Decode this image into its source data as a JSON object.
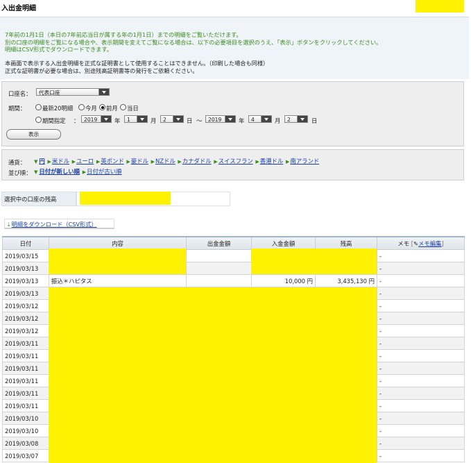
{
  "page": {
    "title": "入出金明細"
  },
  "notice": {
    "lines_green": [
      "7年前の1月1日（本日の7年前応当日が属する年の1月1日）までの明細をご覧いただけます。",
      "別の口座の明細をご覧になる場合や、表示期間を変えてご覧になる場合は、以下の必要項目を選択のうえ、「表示」ボタンをクリックしてください。",
      "明細はCSV形式でダウンロードできます。"
    ],
    "lines_dark": [
      "本画面で表示する入出金明細を正式な証明書として使用することはできません。（印刷した場合も同様）",
      "正式な証明書が必要な場合は、別途残高証明書等の発行をご依頼ください。"
    ]
  },
  "filter": {
    "account_label": "口座名：",
    "account_value": "代表口座",
    "period_label": "期間：",
    "radio_latest20": "最新20明細",
    "radio_this_month": "今月",
    "radio_last_month": "前月",
    "radio_today": "当日",
    "radio_range": "期間指定",
    "range_colon": "：",
    "from_year": "2019",
    "from_month": "1",
    "from_day": "2",
    "to_year": "2019",
    "to_month": "4",
    "to_day": "2",
    "unit_year": "年",
    "unit_month": "月",
    "unit_day": "日",
    "tilde": "～",
    "selected_radio": "前月",
    "show_button": "表示"
  },
  "currency": {
    "label": "通貨：",
    "items": [
      "円",
      "米ドル",
      "ユーロ",
      "英ポンド",
      "豪ドル",
      "NZドル",
      "カナダドル",
      "スイスフラン",
      "香港ドル",
      "南アランド"
    ],
    "selected": "円",
    "sort_label": "並び順：",
    "sort_items": [
      "日付が新しい順",
      "日付が古い順"
    ],
    "sort_selected": "日付が新しい順"
  },
  "balance": {
    "label": "選択中の口座の残高"
  },
  "download": {
    "label": "明細をダウンロード（CSV形式）"
  },
  "table": {
    "headers": {
      "date": "日付",
      "description": "内容",
      "withdrawal": "出金金額",
      "deposit": "入金金額",
      "balance": "残高",
      "memo": "メモ",
      "memo_edit": "メモ編集"
    },
    "rows": [
      {
        "date": "2019/03/15",
        "description": "",
        "withdrawal": "",
        "deposit": "",
        "balance": "",
        "memo": "-"
      },
      {
        "date": "2019/03/13",
        "description": "",
        "withdrawal": "",
        "deposit": "",
        "balance": "",
        "memo": "-"
      },
      {
        "date": "2019/03/13",
        "description": "振込＊ハピタス",
        "withdrawal": "",
        "deposit": "10,000 円",
        "balance": "3,435,130 円",
        "memo": "-"
      },
      {
        "date": "2019/03/13",
        "description": "",
        "withdrawal": "",
        "deposit": "",
        "balance": "",
        "memo": "-"
      },
      {
        "date": "2019/03/12",
        "description": "",
        "withdrawal": "",
        "deposit": "",
        "balance": "",
        "memo": "-"
      },
      {
        "date": "2019/03/12",
        "description": "",
        "withdrawal": "",
        "deposit": "",
        "balance": "",
        "memo": "-"
      },
      {
        "date": "2019/03/12",
        "description": "",
        "withdrawal": "",
        "deposit": "",
        "balance": "",
        "memo": "-"
      },
      {
        "date": "2019/03/11",
        "description": "",
        "withdrawal": "",
        "deposit": "",
        "balance": "",
        "memo": "-"
      },
      {
        "date": "2019/03/11",
        "description": "",
        "withdrawal": "",
        "deposit": "",
        "balance": "",
        "memo": "-"
      },
      {
        "date": "2019/03/11",
        "description": "",
        "withdrawal": "",
        "deposit": "",
        "balance": "",
        "memo": "-"
      },
      {
        "date": "2019/03/11",
        "description": "",
        "withdrawal": "",
        "deposit": "",
        "balance": "",
        "memo": "-"
      },
      {
        "date": "2019/03/11",
        "description": "",
        "withdrawal": "",
        "deposit": "",
        "balance": "",
        "memo": "-"
      },
      {
        "date": "2019/03/11",
        "description": "",
        "withdrawal": "",
        "deposit": "",
        "balance": "",
        "memo": "-"
      },
      {
        "date": "2019/03/10",
        "description": "",
        "withdrawal": "",
        "deposit": "",
        "balance": "",
        "memo": "-"
      },
      {
        "date": "2019/03/10",
        "description": "",
        "withdrawal": "",
        "deposit": "",
        "balance": "",
        "memo": "-"
      },
      {
        "date": "2019/03/08",
        "description": "",
        "withdrawal": "",
        "deposit": "",
        "balance": "",
        "memo": "-"
      },
      {
        "date": "2019/03/07",
        "description": "",
        "withdrawal": "",
        "deposit": "",
        "balance": "",
        "memo": "-"
      }
    ]
  },
  "colors": {
    "redaction": "#fff200",
    "link": "#1a3fa8",
    "green": "#3c8c1e"
  }
}
